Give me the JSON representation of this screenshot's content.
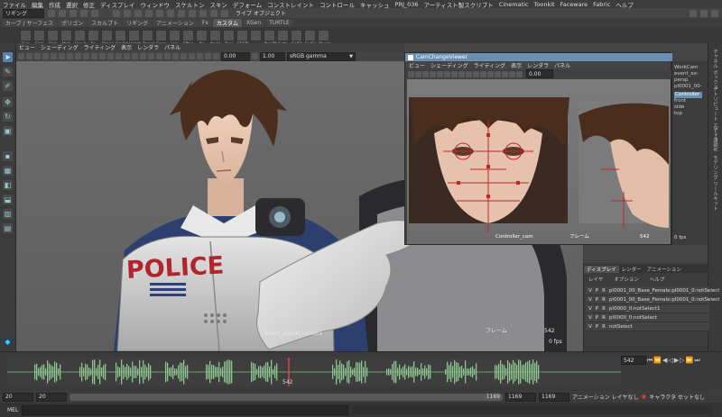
{
  "menubar": {
    "items": [
      "ファイル",
      "編集",
      "作成",
      "選択",
      "修正",
      "ディスプレイ",
      "ウィンドウ",
      "スケルトン",
      "スキン",
      "デフォーム",
      "コンストレイント",
      "コントロール",
      "キャッシュ",
      "PRJ_036",
      "アーティスト製スクリプト",
      "Cinematic",
      "Toonkit",
      "Faceware",
      "Fabric",
      "ヘルプ"
    ]
  },
  "statusline": {
    "mode": "リギング",
    "value1": "0.00",
    "value2": "1.00",
    "colorspace": "sRGB gamma",
    "right_text": "ライブ オブジェクト"
  },
  "shelf": {
    "tabs": [
      "カーブ / サーフェス",
      "ポリゴン",
      "スカルプト",
      "リギング",
      "アニメーション",
      "Fx",
      "カスタム",
      "XGen",
      "TURTLE"
    ],
    "active_tab": "カスタム",
    "buttons": [
      "Con",
      "Cnkj",
      "Dell",
      "Mab",
      "Hand",
      "Ro",
      "Brans",
      "Crelkb",
      "Hatch",
      "Tranal",
      "Canc",
      "Lim",
      "Eftpe",
      "Ko",
      "Node",
      "Tool",
      "ESSPI",
      "",
      "NeaPf",
      "Seltr",
      "SelSt",
      "SelCr",
      "Plugin"
    ]
  },
  "toolbox": {
    "tools": [
      "select",
      "lasso",
      "paint",
      "move",
      "rotate",
      "scale",
      "show"
    ]
  },
  "rightstrip": {
    "tabs": [
      "チャネル ボックス",
      "アトリビュート エディタ",
      "ツール設定",
      "モデリング ツールキット"
    ]
  },
  "viewport": {
    "menu": [
      "ビュー",
      "シェーディング",
      "ライティング",
      "表示",
      "レンダラ",
      "パネル"
    ],
    "field1": "0.00",
    "field2": "1.00",
    "gamma": "sRGB gamma",
    "camera_label": "event_export camera",
    "frame_label": "フレーム",
    "fps_label": "0 fps",
    "frame_number": "542",
    "vest_text": "POLICE"
  },
  "camwin": {
    "title": "CamChangeViewer",
    "menu": [
      "ビュー",
      "シェーディング",
      "ライティング",
      "表示",
      "レンダラ",
      "パネル"
    ],
    "field": "0.00",
    "camera": "Controller_cam",
    "frame_label": "フレーム",
    "frame_value": "542",
    "fps": "0 fps"
  },
  "campanel": {
    "items": [
      "WorkCam",
      "event_ex-",
      "persp",
      "pl0001_00-",
      "",
      "Controller",
      "front",
      "side",
      "top"
    ],
    "selected": "Controller"
  },
  "layers": {
    "tabs": [
      "ディスプレイ",
      "レンダー",
      "アニメーション"
    ],
    "menu": [
      "レイヤ",
      "オプション",
      "ヘルプ"
    ],
    "rows": [
      {
        "v": "V",
        "p": "P",
        "r": "R",
        "name": "pl0001_00_Base_Female:pl0001_0:notSelect"
      },
      {
        "v": "V",
        "p": "P",
        "r": "R",
        "name": "pl0001_00_Base_Female:pl0001_0:notSelect"
      },
      {
        "v": "V",
        "p": "P",
        "r": "R",
        "name": "pl0000_0:notSelect1"
      },
      {
        "v": "V",
        "p": "P",
        "r": "R",
        "name": "pl0000_0:notSelect"
      },
      {
        "v": "V",
        "p": "P",
        "r": "R",
        "name": "notSelect"
      }
    ]
  },
  "timeline": {
    "current": "542",
    "playhead": "542"
  },
  "range": {
    "start1": "20",
    "start2": "20",
    "end1": "1169",
    "end2": "1169",
    "end3": "1169",
    "anim_layer": "アニメーション レイヤなし",
    "char_set": "キャラクタ セットなし"
  },
  "command": {
    "label": "MEL"
  }
}
